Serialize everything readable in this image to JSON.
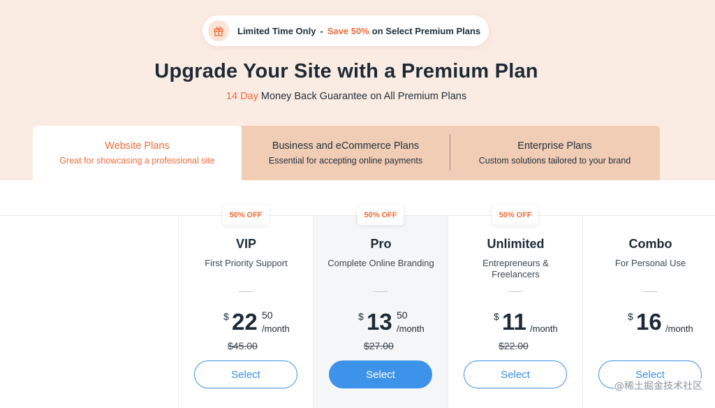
{
  "colors": {
    "accent": "#f26b3a",
    "primary_blue": "#3d92ea",
    "hero_bg": "#fbece3",
    "tab_bg": "#f2cdb5"
  },
  "promo": {
    "icon": "gift-icon",
    "label": "Limited Time Only",
    "separator": "-",
    "accent": "Save 50%",
    "tail": "on Select Premium Plans"
  },
  "headline": "Upgrade Your Site with a Premium Plan",
  "subline": {
    "accent": "14 Day",
    "rest": "Money Back Guarantee on All Premium Plans"
  },
  "tabs": [
    {
      "title": "Website Plans",
      "subtitle": "Great for showcasing a professional site",
      "active": true
    },
    {
      "title": "Business and eCommerce Plans",
      "subtitle": "Essential for accepting online payments",
      "active": false
    },
    {
      "title": "Enterprise Plans",
      "subtitle": "Custom solutions tailored to your brand",
      "active": false
    }
  ],
  "plans": [
    {
      "badge": "50% OFF",
      "name": "VIP",
      "description": "First Priority Support",
      "currency": "$",
      "amount": "22",
      "cents": "50",
      "period": "/month",
      "old_price": "$45.00",
      "button": "Select",
      "highlighted": false
    },
    {
      "badge": "50% OFF",
      "name": "Pro",
      "description": "Complete Online Branding",
      "currency": "$",
      "amount": "13",
      "cents": "50",
      "period": "/month",
      "old_price": "$27.00",
      "button": "Select",
      "highlighted": true
    },
    {
      "badge": "50% OFF",
      "name": "Unlimited",
      "description": "Entrepreneurs & Freelancers",
      "currency": "$",
      "amount": "11",
      "cents": "",
      "period": "/month",
      "old_price": "$22.00",
      "button": "Select",
      "highlighted": false
    },
    {
      "badge": "",
      "name": "Combo",
      "description": "For Personal Use",
      "currency": "$",
      "amount": "16",
      "cents": "",
      "period": "/month",
      "old_price": "",
      "button": "Select",
      "highlighted": false
    }
  ],
  "watermark": "@稀土掘金技术社区"
}
